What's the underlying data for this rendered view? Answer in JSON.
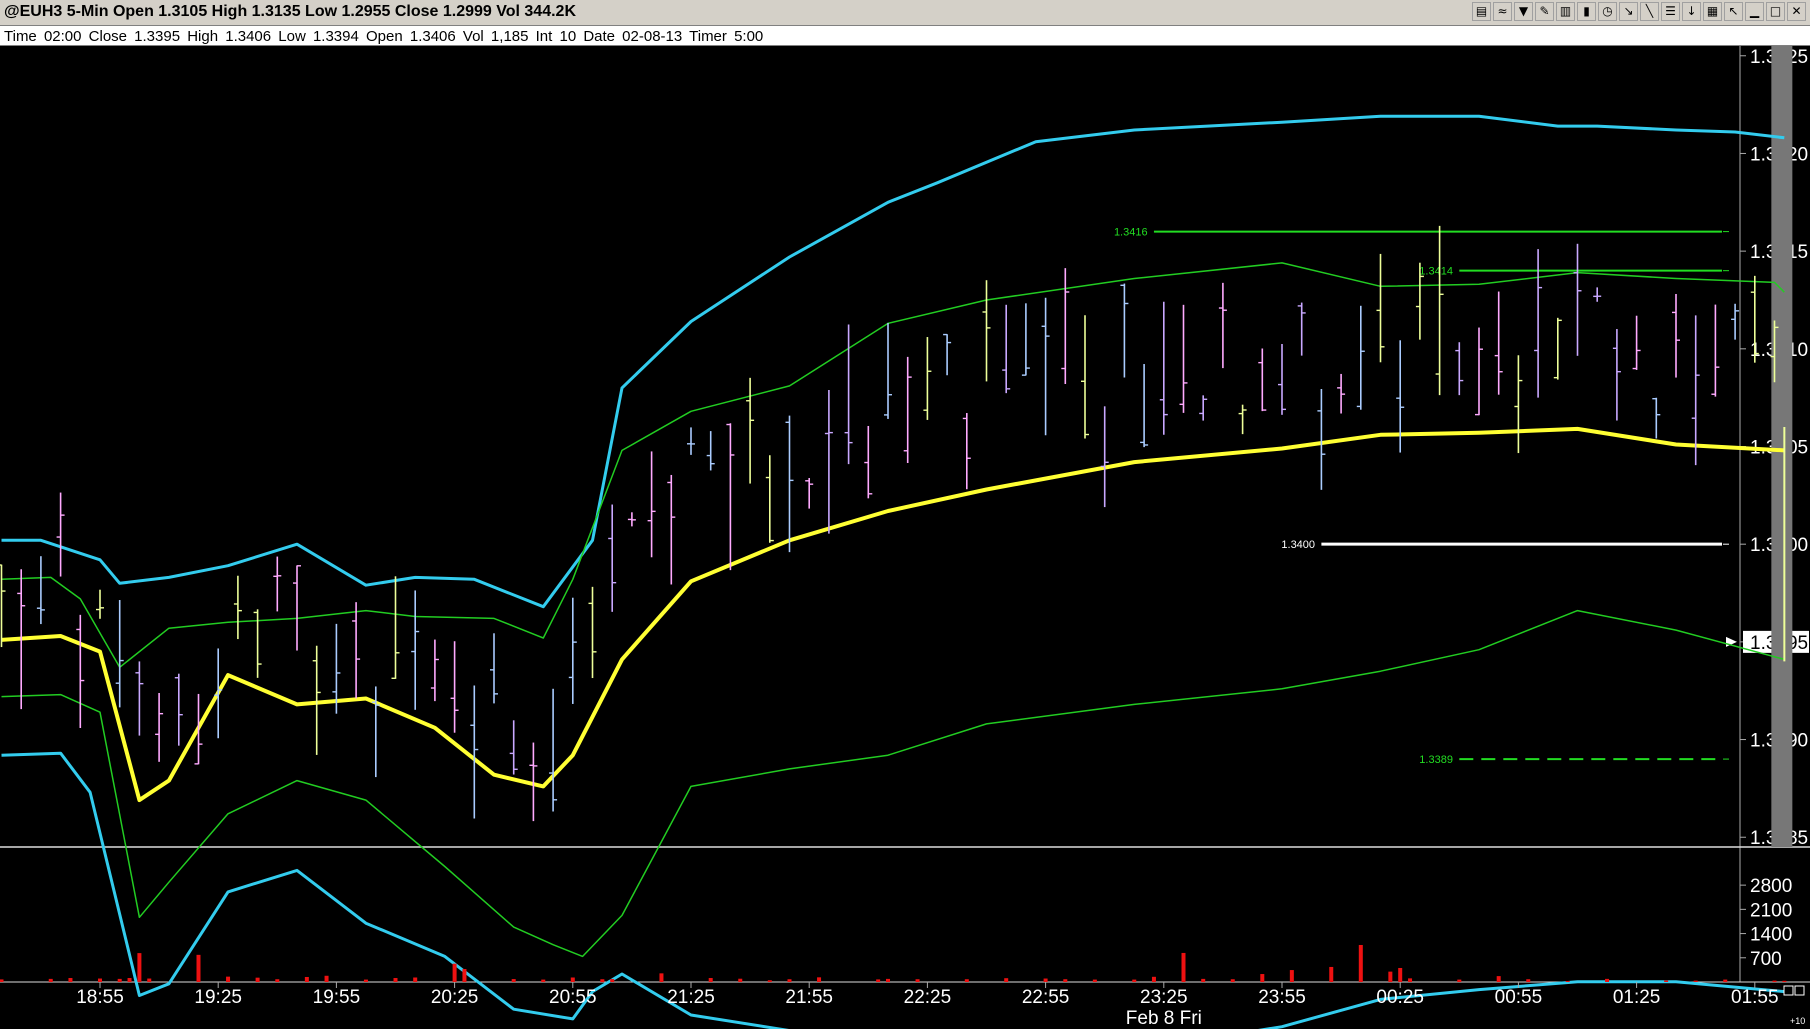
{
  "window": {
    "title": "@EUH3 5-Min Open 1.3105 High 1.3135 Low 1.2955 Close 1.2999 Vol 344.2K",
    "info": "Time 02:00   Close 1.3395   High 1.3406   Low 1.3394   Open 1.3406   Vol 1,185   Int 10   Date 02-08-13   Timer 5:00",
    "toolbar_icons": [
      "chart-icon",
      "fib-arc-icon",
      "filter-icon",
      "pencil-icon",
      "bar-chart-icon",
      "candle-icon",
      "clock-icon",
      "cursor-icon",
      "line-tool-icon",
      "fib-icon",
      "arrow-down-icon",
      "trash-icon",
      "pointer-icon",
      "minimize-icon",
      "maximize-icon",
      "close-icon"
    ]
  },
  "chart_data": {
    "type": "bar",
    "symbol": "@EUH3",
    "interval": "5-Min",
    "x_ticks": [
      "18:55",
      "19:25",
      "19:55",
      "20:25",
      "20:55",
      "21:25",
      "21:55",
      "22:25",
      "22:55",
      "23:25",
      "23:55",
      "00:25",
      "00:55",
      "01:25",
      "01:55"
    ],
    "date_label": "Feb 8 Fri",
    "y_ticks": [
      "1.3425",
      "1.3420",
      "1.3415",
      "1.3410",
      "1.3405",
      "1.3400",
      "1.3395",
      "1.3390",
      "1.3385"
    ],
    "ylim": [
      1.33845,
      1.34255
    ],
    "last_price": "1.3395",
    "volume_ticks": [
      "2800",
      "2100",
      "1400",
      "700"
    ],
    "volume_ylim": [
      0,
      3700
    ],
    "corner_label": "+10",
    "horizontal_lines": [
      {
        "label": "1.3416",
        "value": 1.3416,
        "color": "#22dd22",
        "style": "solid"
      },
      {
        "label": "1.3414",
        "value": 1.3414,
        "color": "#22dd22",
        "style": "solid"
      },
      {
        "label": "1.3400",
        "value": 1.34,
        "color": "#ffffff",
        "style": "solid"
      },
      {
        "label": "1.3389",
        "value": 1.3389,
        "color": "#22dd22",
        "style": "dashed"
      }
    ],
    "band_colors": {
      "outer": "#33ccee",
      "inner": "#22cc22",
      "middle": "#ffff33"
    },
    "bar_colors": [
      "#c9a8ff",
      "#ffaaff",
      "#eeff99",
      "#aaccff"
    ],
    "volume_color": "#ee1111",
    "gray_bar_color": "#777777",
    "n_bars": 97,
    "bands": {
      "upper_outer": [
        [
          0,
          1.34002
        ],
        [
          4,
          1.34002
        ],
        [
          10,
          1.33992
        ],
        [
          12,
          1.3398
        ],
        [
          17,
          1.33983
        ],
        [
          23,
          1.33989
        ],
        [
          30,
          1.34
        ],
        [
          37,
          1.33979
        ],
        [
          42,
          1.33983
        ],
        [
          48,
          1.33982
        ],
        [
          55,
          1.33968
        ],
        [
          60,
          1.34002
        ],
        [
          63,
          1.3408
        ],
        [
          70,
          1.34114
        ],
        [
          80,
          1.34147
        ],
        [
          90,
          1.34175
        ],
        [
          95,
          1.34185
        ],
        [
          105,
          1.34206
        ],
        [
          115,
          1.34212
        ],
        [
          130,
          1.34216
        ],
        [
          140,
          1.34219
        ],
        [
          150,
          1.34219
        ],
        [
          158,
          1.34214
        ],
        [
          162,
          1.34214
        ],
        [
          170,
          1.34212
        ],
        [
          176,
          1.34211
        ],
        [
          181,
          1.34208
        ]
      ],
      "upper_inner": [
        [
          0,
          1.33982
        ],
        [
          5,
          1.33983
        ],
        [
          8,
          1.33972
        ],
        [
          12,
          1.33937
        ],
        [
          17,
          1.33957
        ],
        [
          23,
          1.3396
        ],
        [
          30,
          1.33962
        ],
        [
          37,
          1.33966
        ],
        [
          42,
          1.33963
        ],
        [
          50,
          1.33962
        ],
        [
          55,
          1.33952
        ],
        [
          58,
          1.33982
        ],
        [
          63,
          1.34048
        ],
        [
          70,
          1.34068
        ],
        [
          80,
          1.34081
        ],
        [
          90,
          1.34113
        ],
        [
          100,
          1.34125
        ],
        [
          115,
          1.34136
        ],
        [
          130,
          1.34144
        ],
        [
          140,
          1.34132
        ],
        [
          150,
          1.34133
        ],
        [
          160,
          1.34139
        ],
        [
          170,
          1.34136
        ],
        [
          180,
          1.34134
        ],
        [
          181,
          1.34129
        ]
      ],
      "middle": [
        [
          0,
          1.33951
        ],
        [
          6,
          1.33953
        ],
        [
          10,
          1.33945
        ],
        [
          14,
          1.33869
        ],
        [
          17,
          1.33879
        ],
        [
          23,
          1.33933
        ],
        [
          30,
          1.33918
        ],
        [
          37,
          1.33921
        ],
        [
          44,
          1.33906
        ],
        [
          50,
          1.33882
        ],
        [
          55,
          1.33876
        ],
        [
          58,
          1.33892
        ],
        [
          63,
          1.33941
        ],
        [
          70,
          1.33981
        ],
        [
          80,
          1.34002
        ],
        [
          90,
          1.34017
        ],
        [
          100,
          1.34028
        ],
        [
          115,
          1.34042
        ],
        [
          130,
          1.34049
        ],
        [
          140,
          1.34056
        ],
        [
          150,
          1.34057
        ],
        [
          160,
          1.34059
        ],
        [
          170,
          1.34051
        ],
        [
          181,
          1.34048
        ]
      ],
      "lower_inner": [
        [
          0,
          1.33922
        ],
        [
          6,
          1.33923
        ],
        [
          10,
          1.33914
        ],
        [
          14,
          1.33809
        ],
        [
          17,
          1.33827
        ],
        [
          23,
          1.33862
        ],
        [
          30,
          1.33879
        ],
        [
          37,
          1.33869
        ],
        [
          45,
          1.33835
        ],
        [
          52,
          1.33804
        ],
        [
          56,
          1.33795
        ],
        [
          59,
          1.33789
        ],
        [
          63,
          1.3381
        ],
        [
          70,
          1.33876
        ],
        [
          80,
          1.33885
        ],
        [
          90,
          1.33892
        ],
        [
          100,
          1.33908
        ],
        [
          115,
          1.33918
        ],
        [
          130,
          1.33926
        ],
        [
          140,
          1.33935
        ],
        [
          150,
          1.33946
        ],
        [
          160,
          1.33966
        ],
        [
          170,
          1.33956
        ],
        [
          181,
          1.33941
        ]
      ],
      "lower_outer": [
        [
          0,
          1.33892
        ],
        [
          6,
          1.33893
        ],
        [
          9,
          1.33873
        ],
        [
          14,
          1.33769
        ],
        [
          17,
          1.33775
        ],
        [
          23,
          1.33822
        ],
        [
          30,
          1.33833
        ],
        [
          37,
          1.33806
        ],
        [
          45,
          1.33789
        ],
        [
          52,
          1.33762
        ],
        [
          58,
          1.33757
        ],
        [
          60,
          1.33771
        ],
        [
          63,
          1.3378
        ],
        [
          70,
          1.33759
        ],
        [
          80,
          1.33751
        ],
        [
          90,
          1.33743
        ],
        [
          100,
          1.33746
        ],
        [
          110,
          1.33744
        ],
        [
          120,
          1.33745
        ],
        [
          130,
          1.33753
        ],
        [
          140,
          1.33767
        ],
        [
          150,
          1.33772
        ],
        [
          160,
          1.33776
        ],
        [
          165,
          1.33776
        ],
        [
          170,
          1.33776
        ],
        [
          181,
          1.33771
        ]
      ]
    },
    "volume_bars": [
      [
        0,
        75
      ],
      [
        5,
        90
      ],
      [
        7,
        115
      ],
      [
        10,
        100
      ],
      [
        12,
        90
      ],
      [
        13,
        115
      ],
      [
        14,
        835
      ],
      [
        15,
        100
      ],
      [
        20,
        785
      ],
      [
        23,
        155
      ],
      [
        26,
        125
      ],
      [
        28,
        80
      ],
      [
        31,
        145
      ],
      [
        33,
        180
      ],
      [
        37,
        70
      ],
      [
        40,
        115
      ],
      [
        42,
        130
      ],
      [
        46,
        530
      ],
      [
        47,
        375
      ],
      [
        52,
        85
      ],
      [
        55,
        70
      ],
      [
        58,
        130
      ],
      [
        61,
        80
      ],
      [
        62,
        85
      ],
      [
        67,
        250
      ],
      [
        72,
        115
      ],
      [
        75,
        95
      ],
      [
        78,
        50
      ],
      [
        80,
        80
      ],
      [
        83,
        135
      ],
      [
        89,
        75
      ],
      [
        90,
        90
      ],
      [
        93,
        80
      ],
      [
        98,
        80
      ],
      [
        102,
        110
      ],
      [
        106,
        100
      ],
      [
        108,
        80
      ],
      [
        111,
        70
      ],
      [
        115,
        70
      ],
      [
        117,
        150
      ],
      [
        120,
        840
      ],
      [
        122,
        90
      ],
      [
        125,
        80
      ],
      [
        128,
        230
      ],
      [
        131,
        345
      ],
      [
        135,
        435
      ],
      [
        138,
        1070
      ],
      [
        141,
        300
      ],
      [
        142,
        405
      ],
      [
        143,
        105
      ],
      [
        148,
        70
      ],
      [
        152,
        170
      ],
      [
        155,
        80
      ],
      [
        159,
        30
      ],
      [
        163,
        90
      ],
      [
        169,
        45
      ],
      [
        172,
        40
      ],
      [
        175,
        70
      ],
      [
        180,
        40
      ],
      [
        181,
        35
      ]
    ]
  }
}
